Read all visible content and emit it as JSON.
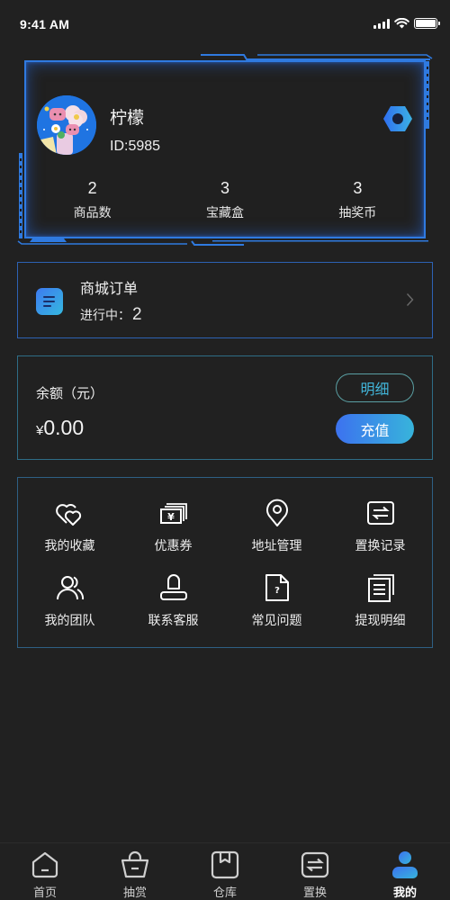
{
  "status_bar": {
    "time": "9:41 AM",
    "battery_level_percent": 100
  },
  "profile": {
    "username": "柠檬",
    "user_id": "ID:5985",
    "avatar_icon": "avatar-flowers-illustration",
    "settings_icon": "hexagon-nut-settings-icon",
    "stats": [
      {
        "value": "2",
        "label": "商品数"
      },
      {
        "value": "3",
        "label": "宝藏盒"
      },
      {
        "value": "3",
        "label": "抽奖币"
      }
    ]
  },
  "orders": {
    "title": "商城订单",
    "status_label": "进行中：",
    "status_count": "2",
    "icon": "document-list-icon"
  },
  "balance": {
    "label": "余额（元）",
    "currency_symbol": "¥",
    "amount": "0.00",
    "detail_button": "明细",
    "recharge_button": "充值"
  },
  "services": [
    {
      "label": "我的收藏",
      "icon": "hearts-icon"
    },
    {
      "label": "优惠券",
      "icon": "coupon-yen-icon"
    },
    {
      "label": "地址管理",
      "icon": "location-pin-icon"
    },
    {
      "label": "置换记录",
      "icon": "swap-icon"
    },
    {
      "label": "我的团队",
      "icon": "team-icon"
    },
    {
      "label": "联系客服",
      "icon": "customer-service-icon"
    },
    {
      "label": "常见问题",
      "icon": "faq-document-icon"
    },
    {
      "label": "提现明细",
      "icon": "withdraw-details-icon"
    }
  ],
  "bottom_nav": {
    "items": [
      {
        "label": "首页",
        "icon": "home-icon"
      },
      {
        "label": "抽赏",
        "icon": "basket-icon"
      },
      {
        "label": "仓库",
        "icon": "warehouse-box-icon"
      },
      {
        "label": "置换",
        "icon": "swap-icon"
      },
      {
        "label": "我的",
        "icon": "user-icon",
        "active": true
      }
    ]
  },
  "colors": {
    "background": "#212121",
    "accent_blue": "#2f7ae0",
    "gradient_start": "#3c72ef",
    "gradient_end": "#37b4db",
    "detail_text": "#41b4d8"
  }
}
